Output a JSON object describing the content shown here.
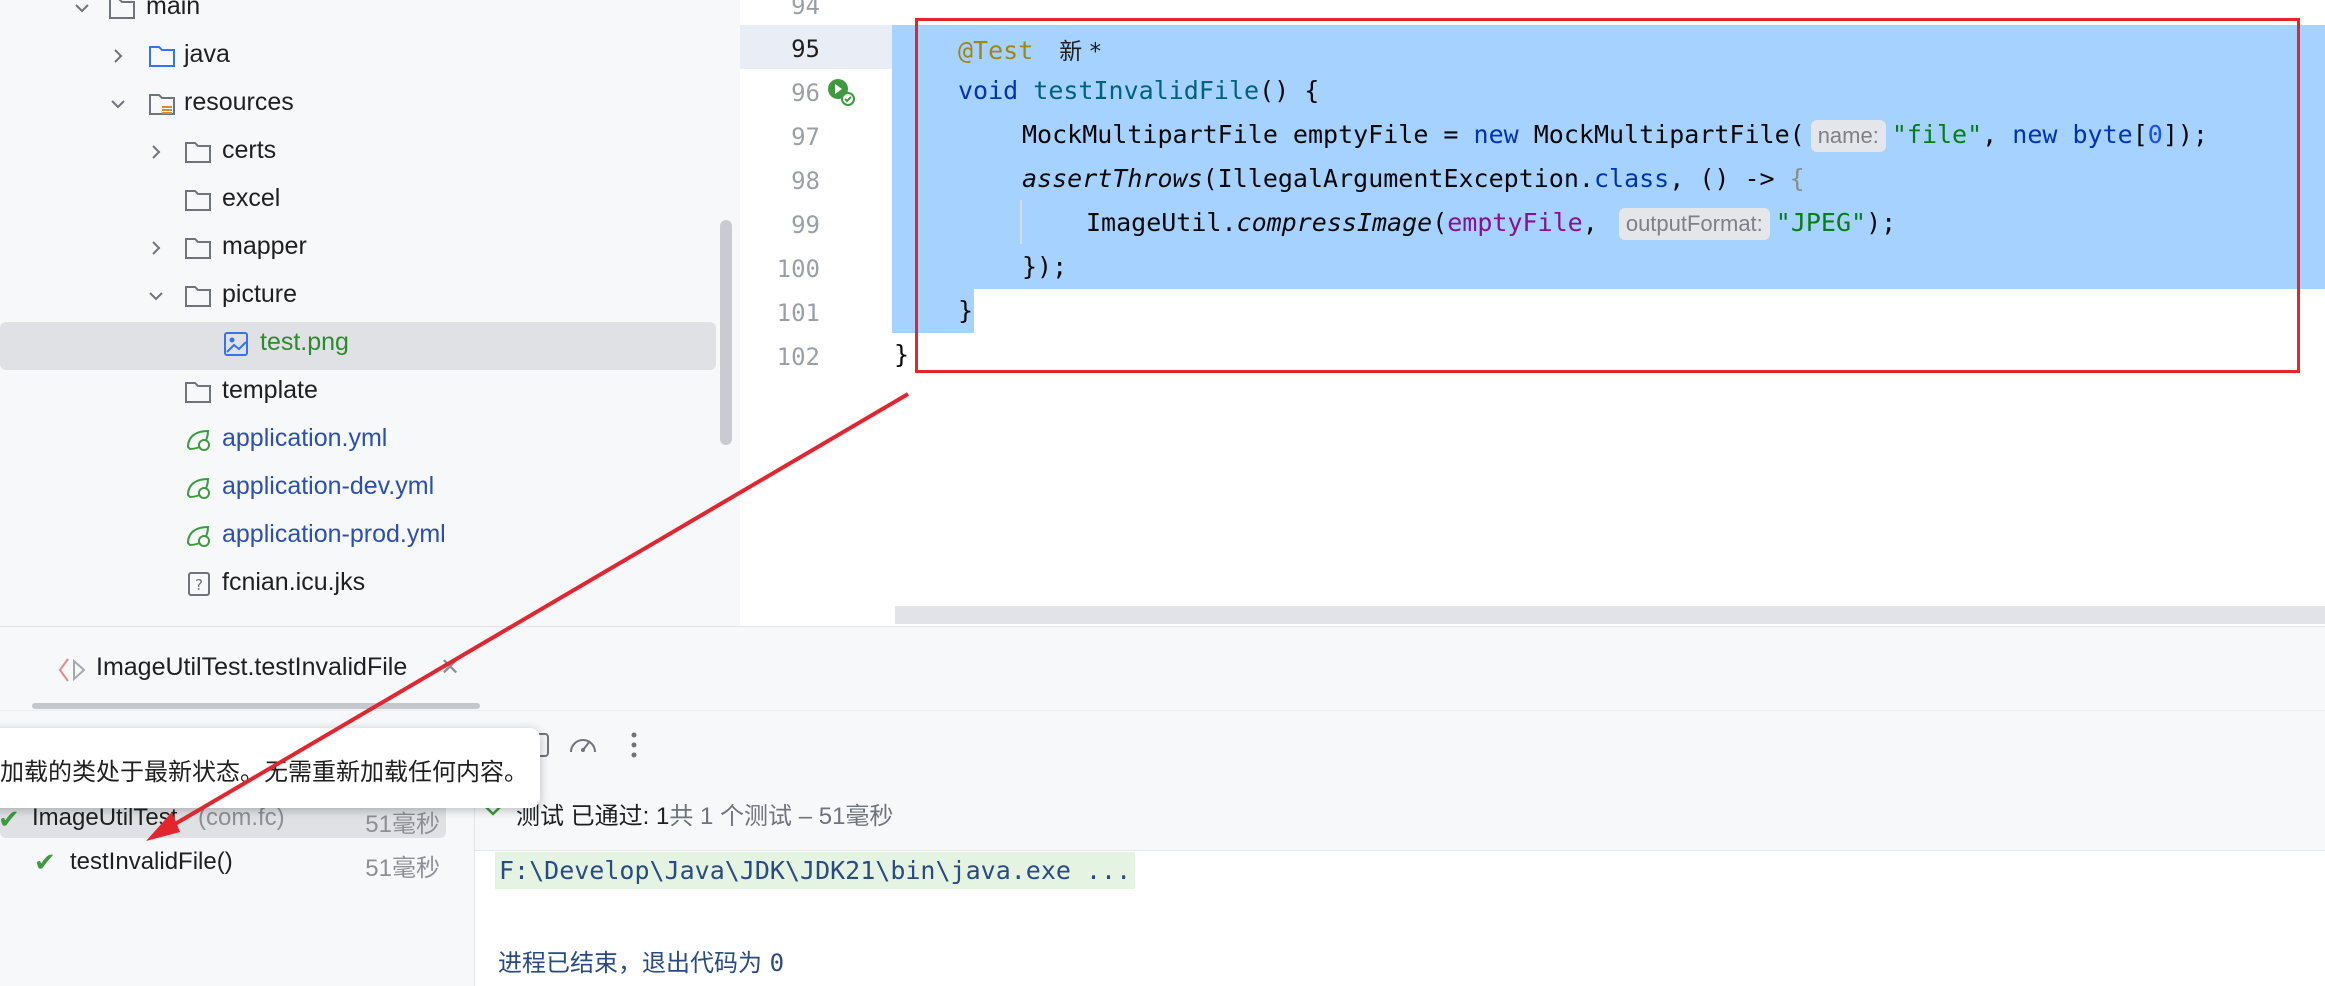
{
  "project_tree": {
    "items": [
      {
        "label": "main",
        "kind": "folder",
        "expanded": true
      },
      {
        "label": "java",
        "kind": "source-folder",
        "expanded": false
      },
      {
        "label": "resources",
        "kind": "resources-folder",
        "expanded": true
      },
      {
        "label": "certs",
        "kind": "folder",
        "expanded": false
      },
      {
        "label": "excel",
        "kind": "folder"
      },
      {
        "label": "mapper",
        "kind": "folder",
        "expanded": false
      },
      {
        "label": "picture",
        "kind": "folder",
        "expanded": true
      },
      {
        "label": "test.png",
        "kind": "image-file",
        "selected": true
      },
      {
        "label": "template",
        "kind": "folder"
      },
      {
        "label": "application.yml",
        "kind": "spring-yml"
      },
      {
        "label": "application-dev.yml",
        "kind": "spring-yml"
      },
      {
        "label": "application-prod.yml",
        "kind": "spring-yml"
      },
      {
        "label": "fcnian.icu.jks",
        "kind": "unknown-file"
      }
    ]
  },
  "editor": {
    "line_numbers": [
      "94",
      "95",
      "96",
      "97",
      "98",
      "99",
      "100",
      "101",
      "102"
    ],
    "annotation": "@Test",
    "author_hint": "新 *",
    "method_kw": "void",
    "method_name": "testInvalidFile",
    "method_tail": "() {",
    "l97_type": "MockMultipartFile emptyFile = ",
    "l97_new": "new",
    "l97_ctor": " MockMultipartFile(",
    "l97_hint": "name:",
    "l97_str": "\"file\"",
    "l97_sep": ", ",
    "l97_new2": "new",
    "l97_byte": "byte",
    "l97_br1": "[",
    "l97_zero": "0",
    "l97_end": "]);",
    "l98_call": "assertThrows",
    "l98_arg": "(IllegalArgumentException.",
    "l98_class": "class",
    "l98_lambda": ", () -> ",
    "l98_brace": "{",
    "l99_obj": "ImageUtil.",
    "l99_method": "compressImage",
    "l99_open": "(",
    "l99_var": "emptyFile",
    "l99_sep": ", ",
    "l99_hint": "outputFormat:",
    "l99_str": "\"JPEG\"",
    "l99_end": ");",
    "l100": "});",
    "l101": "}",
    "l102": "}"
  },
  "run_panel": {
    "tab_label": "ImageUtilTest.testInvalidFile",
    "toast": "加载的类处于最新状态。无需重新加载任何内容。",
    "results": [
      {
        "label": "ImageUtilTest",
        "pkg": "(com.fc)",
        "time": "51毫秒",
        "status": "passed"
      },
      {
        "label": "testInvalidFile()",
        "time": "51毫秒",
        "status": "passed"
      }
    ],
    "status_text_a": "测试",
    "status_text_b": "已通过: 1",
    "status_text_c": "共 1 个测试 – 51毫秒",
    "command": "F:\\Develop\\Java\\JDK\\JDK21\\bin\\java.exe ...",
    "exit": "进程已结束，退出代码为",
    "exit_code": "0"
  },
  "colors": {
    "selection": "#a6d2ff",
    "annotation_red": "#e3252f",
    "pass_green": "#2f8a2f"
  }
}
